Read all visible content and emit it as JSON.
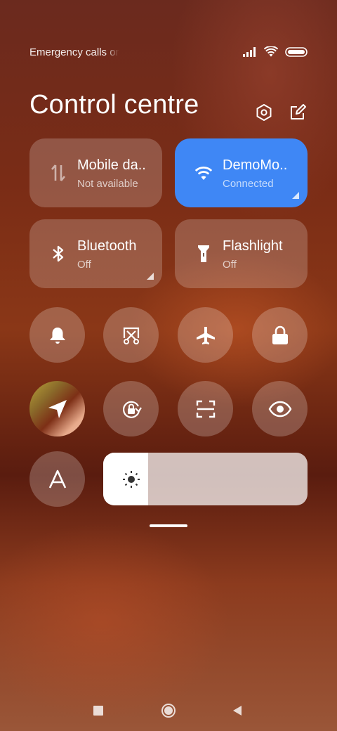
{
  "status_bar": {
    "left_text": "Emergency calls only",
    "icons": [
      "signal-icon",
      "wifi-icon",
      "battery-icon"
    ]
  },
  "header": {
    "title": "Control centre",
    "icons": [
      "settings-icon",
      "edit-icon"
    ]
  },
  "tiles": [
    {
      "name": "Mobile data",
      "shown_label": "Mobile da..",
      "status": "Not available",
      "icon": "mobile-data-icon",
      "active": false
    },
    {
      "name": "DemoMode wifi",
      "shown_label": "DemoMo..",
      "status": "Connected",
      "icon": "wifi-icon",
      "active": true
    },
    {
      "name": "Bluetooth",
      "shown_label": "Bluetooth",
      "status": "Off",
      "icon": "bluetooth-icon",
      "active": false
    },
    {
      "name": "Flashlight",
      "shown_label": "Flashlight",
      "status": "Off",
      "icon": "flashlight-icon",
      "active": false
    }
  ],
  "toggles_row1": [
    "bell-icon",
    "screenshot-icon",
    "airplane-icon",
    "lock-icon"
  ],
  "toggles_row2": [
    "location-icon",
    "auto-rotate-icon",
    "scanner-icon",
    "reading-mode-icon"
  ],
  "toggles_row3": [
    "auto-brightness-icon"
  ],
  "brightness": {
    "level": 0.22,
    "icon": "sun-icon"
  },
  "navigation": [
    "recents-icon",
    "home-icon",
    "back-icon"
  ],
  "colors": {
    "accent": "#3f87f5"
  }
}
